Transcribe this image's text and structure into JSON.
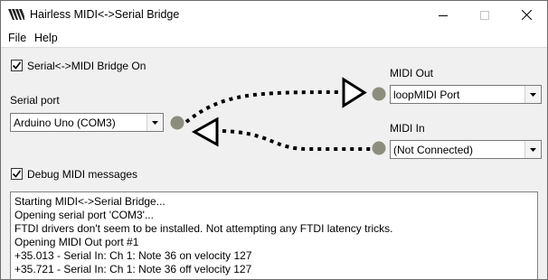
{
  "window": {
    "title": "Hairless MIDI<->Serial Bridge"
  },
  "menu": {
    "items": [
      "File",
      "Help"
    ]
  },
  "bridge": {
    "label": "Serial<->MIDI Bridge On",
    "checked": true
  },
  "serial": {
    "label": "Serial port",
    "value": "Arduino Uno (COM3)"
  },
  "midi_out": {
    "label": "MIDI Out",
    "value": "loopMIDI Port"
  },
  "midi_in": {
    "label": "MIDI In",
    "value": "(Not Connected)"
  },
  "debug": {
    "label": "Debug MIDI messages",
    "checked": true
  },
  "log": {
    "lines": [
      "Starting MIDI<->Serial Bridge...",
      "Opening serial port 'COM3'...",
      "FTDI drivers don't seem to be installed. Not attempting any FTDI latency tricks.",
      "Opening MIDI Out port #1",
      "+35.013 - Serial In: Ch 1: Note 36 on  velocity 127",
      "+35.721 - Serial In: Ch 1: Note 36 off velocity 127"
    ]
  },
  "colors": {
    "node": "#8d8d7e",
    "line": "#000000"
  }
}
